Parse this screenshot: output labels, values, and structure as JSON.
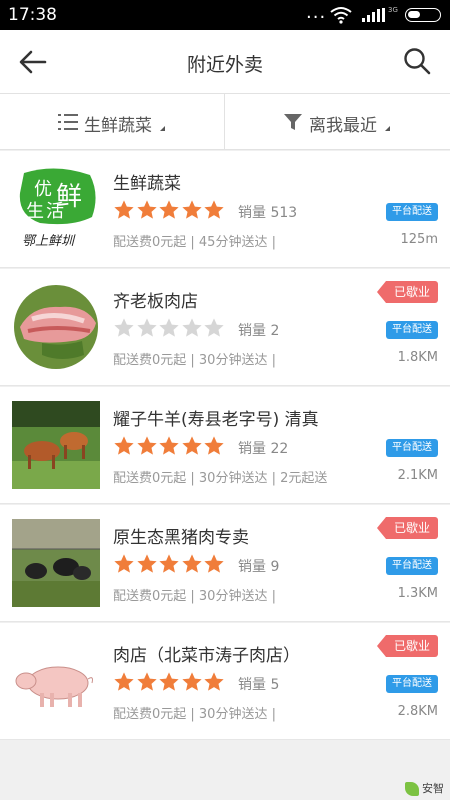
{
  "status_bar": {
    "time": "17:38",
    "dots": "...",
    "network": "3G"
  },
  "header": {
    "title": "附近外卖"
  },
  "filters": [
    {
      "label": "生鲜蔬菜",
      "icon": "list-icon"
    },
    {
      "label": "离我最近",
      "icon": "funnel-icon"
    }
  ],
  "labels": {
    "closed": "已歇业",
    "platform": "平台配送"
  },
  "shops": [
    {
      "name": "生鲜蔬菜",
      "rating": 5,
      "sales": "销量 513",
      "meta": "配送费0元起 | 45分钟送达 |",
      "distance": "125m",
      "closed": false,
      "thumb": "youxian-shenghuo-logo",
      "logo_text": [
        "优",
        "鲜",
        "生",
        "活",
        "鄂上鲜圳"
      ]
    },
    {
      "name": "齐老板肉店",
      "rating": 0,
      "sales": "销量 2",
      "meta": "配送费0元起 | 30分钟送达 |",
      "distance": "1.8KM",
      "closed": true,
      "thumb": "pork-meat-photo"
    },
    {
      "name": "耀子牛羊(寿县老字号) 清真",
      "rating": 5,
      "sales": "销量 22",
      "meta": "配送费0元起 | 30分钟送达 | 2元起送",
      "distance": "2.1KM",
      "closed": false,
      "thumb": "cattle-photo"
    },
    {
      "name": "原生态黑猪肉专卖",
      "rating": 5,
      "sales": "销量 9",
      "meta": "配送费0元起 | 30分钟送达 |",
      "distance": "1.3KM",
      "closed": true,
      "thumb": "black-pig-photo"
    },
    {
      "name": "肉店（北菜市涛子肉店）",
      "rating": 5,
      "sales": "销量 5",
      "meta": "配送费0元起 | 30分钟送达 |",
      "distance": "2.8KM",
      "closed": true,
      "thumb": "pig-illustration"
    }
  ],
  "watermark": "安智",
  "colors": {
    "star": "#f07d3a",
    "star_empty": "#d6d6d6",
    "closed_badge": "#ef6b6b",
    "platform_badge": "#2f9be8",
    "logo_green": "#3aa935"
  }
}
